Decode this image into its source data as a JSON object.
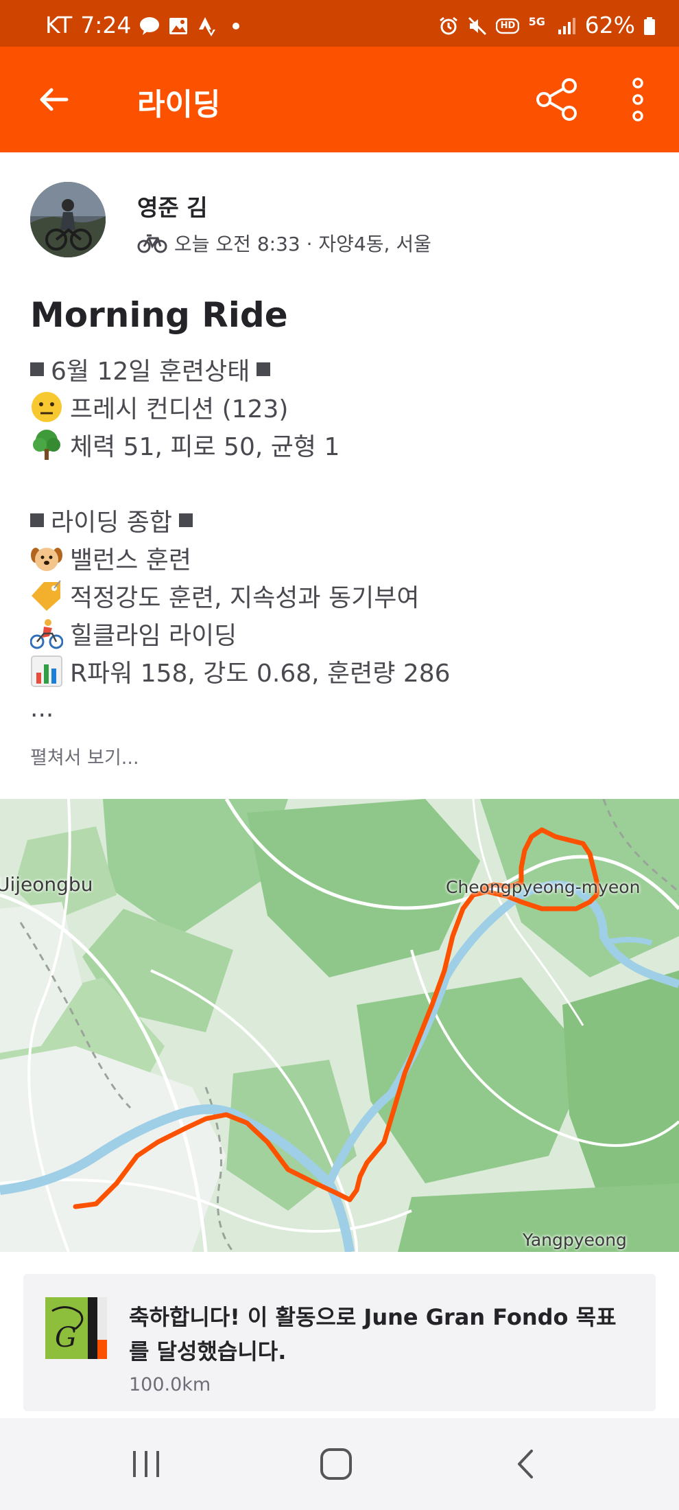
{
  "status_bar": {
    "carrier": "KT",
    "time": "7:24",
    "battery": "62%",
    "icons": [
      "talk-icon",
      "image-icon",
      "strava-icon",
      "dot-icon",
      "alarm-icon",
      "mute-icon",
      "hd-icon",
      "5g-icon",
      "signal-icon",
      "battery-icon"
    ],
    "hd_label": "HD",
    "net_label": "5G"
  },
  "app_bar": {
    "title": "라이딩",
    "back_icon": "arrow-left-icon",
    "share_icon": "share-icon",
    "more_icon": "more-vertical-icon"
  },
  "athlete": {
    "name": "영준 김",
    "activity_icon": "bicycle-icon",
    "meta": "오늘 오전 8:33 · 자양4동, 서울"
  },
  "activity": {
    "title": "Morning Ride",
    "description": [
      {
        "icon": "",
        "text": "6월 12일 훈련상태",
        "boxed": true
      },
      {
        "icon": "neutral-face-icon",
        "text": "프레시 컨디션 (123)"
      },
      {
        "icon": "tree-icon",
        "text": "체력 51, 피로 50, 균형 1"
      },
      {
        "icon": "",
        "text": ""
      },
      {
        "icon": "",
        "text": "라이딩 종합",
        "boxed": true
      },
      {
        "icon": "dog-icon",
        "text": "밸런스 훈련"
      },
      {
        "icon": "tag-icon",
        "text": "적정강도 훈련, 지속성과 동기부여"
      },
      {
        "icon": "cyclist-icon",
        "text": "힐클라임 라이딩"
      },
      {
        "icon": "bar-chart-icon",
        "text": "R파워 158, 강도 0.68, 훈련량 286"
      },
      {
        "icon": "",
        "text": "..."
      }
    ],
    "expand_label": "펼쳐서 보기..."
  },
  "map": {
    "labels": [
      "Uijeongbu",
      "Cheongpyeong-myeon",
      "Yangpyeong"
    ],
    "route_color": "#fc5200"
  },
  "achievement": {
    "badge_icon": "gran-fondo-badge-icon",
    "badge_text": "G",
    "message": "축하합니다! 이 활동으로 June Gran Fondo 목표를 달성했습니다.",
    "distance": "100.0km"
  },
  "nav_bar": {
    "recents_icon": "recents-icon",
    "home_icon": "home-icon",
    "back_icon": "nav-back-icon"
  }
}
